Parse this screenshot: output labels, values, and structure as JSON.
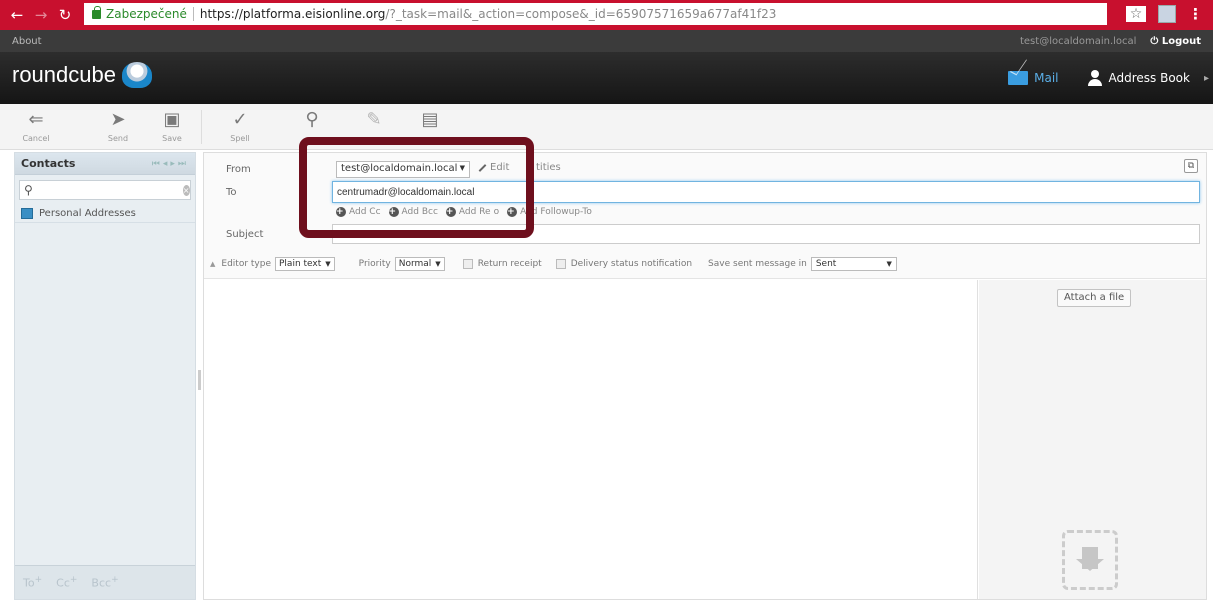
{
  "browser": {
    "secure_label": "Zabezpečené",
    "url_host": "https://platforma.eisionline.org",
    "url_rest": "/?_task=mail&_action=compose&_id=65907571659a677af41f23"
  },
  "topbar": {
    "about": "About",
    "user": "test@localdomain.local",
    "logout": "Logout"
  },
  "header": {
    "logo": "roundcube",
    "nav": [
      {
        "label": "Mail"
      },
      {
        "label": "Address Book"
      }
    ]
  },
  "toolbar": {
    "buttons": [
      {
        "label": "Cancel"
      },
      {
        "label": "Send"
      },
      {
        "label": "Save"
      },
      {
        "label": "Spell"
      }
    ]
  },
  "contacts": {
    "title": "Contacts",
    "search_placeholder": "",
    "addressbook": "Personal Addresses",
    "bottom": [
      "To",
      "Cc",
      "Bcc"
    ]
  },
  "compose": {
    "from_label": "From",
    "from_value": "test@localdomain.local",
    "edit_label": "Edit",
    "identities_label": "tities",
    "to_label": "To",
    "to_value": "centrumadr@localdomain.local",
    "add_links": [
      "Add Cc",
      "Add Bcc",
      "Add Re",
      "o",
      "Add Followup-To"
    ],
    "subject_label": "Subject",
    "subject_value": "",
    "editor_type_label": "Editor type",
    "editor_type_value": "Plain text",
    "priority_label": "Priority",
    "priority_value": "Normal",
    "return_receipt": "Return receipt",
    "dsn": "Delivery status notification",
    "save_sent_label": "Save sent message in",
    "save_sent_value": "Sent",
    "attach_label": "Attach a file"
  }
}
